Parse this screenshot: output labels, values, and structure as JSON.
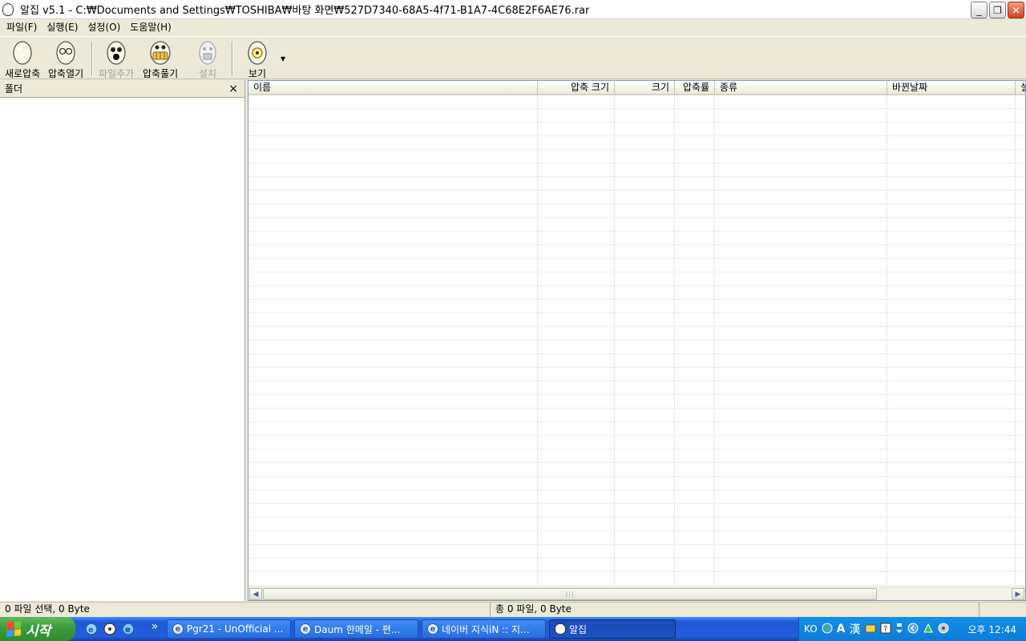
{
  "window": {
    "title": "알집 v5.1 - C:₩Documents and Settings₩TOSHIBA₩바탕 화면₩527D7340-68A5-4f71-B1A7-4C68E2F6AE76.rar",
    "min": "_",
    "restore": "❐",
    "close": "✕"
  },
  "menu": [
    "파일(F)",
    "실행(E)",
    "설정(O)",
    "도움말(H)"
  ],
  "toolbar": {
    "new": "새로압축",
    "open": "압축열기",
    "add": "파일추가",
    "extract": "압축풀기",
    "install": "설치",
    "view": "보기",
    "dropdown": "▼"
  },
  "folder_pane": {
    "title": "폴더",
    "close": "×"
  },
  "columns": [
    "이름",
    "압축 크기",
    "크기",
    "압축률",
    "종류",
    "바뀐날짜",
    "설"
  ],
  "scrollbar": {
    "left": "◀",
    "right": "▶",
    "grip": "|||"
  },
  "status": {
    "selection": "0 파일 선택,  0 Byte",
    "total": "총 0 파일,  0 Byte"
  },
  "taskbar": {
    "start": "시작",
    "chevron": "»",
    "tasks": [
      "Pgr21 - UnOfficial ...",
      "Daum 한메일 - 편...",
      "네이버 지식iN :: 지...",
      "알집"
    ],
    "tray_lang": "KO",
    "tray_a": "A",
    "tray_han": "漢",
    "clock": "오후 12:44"
  }
}
